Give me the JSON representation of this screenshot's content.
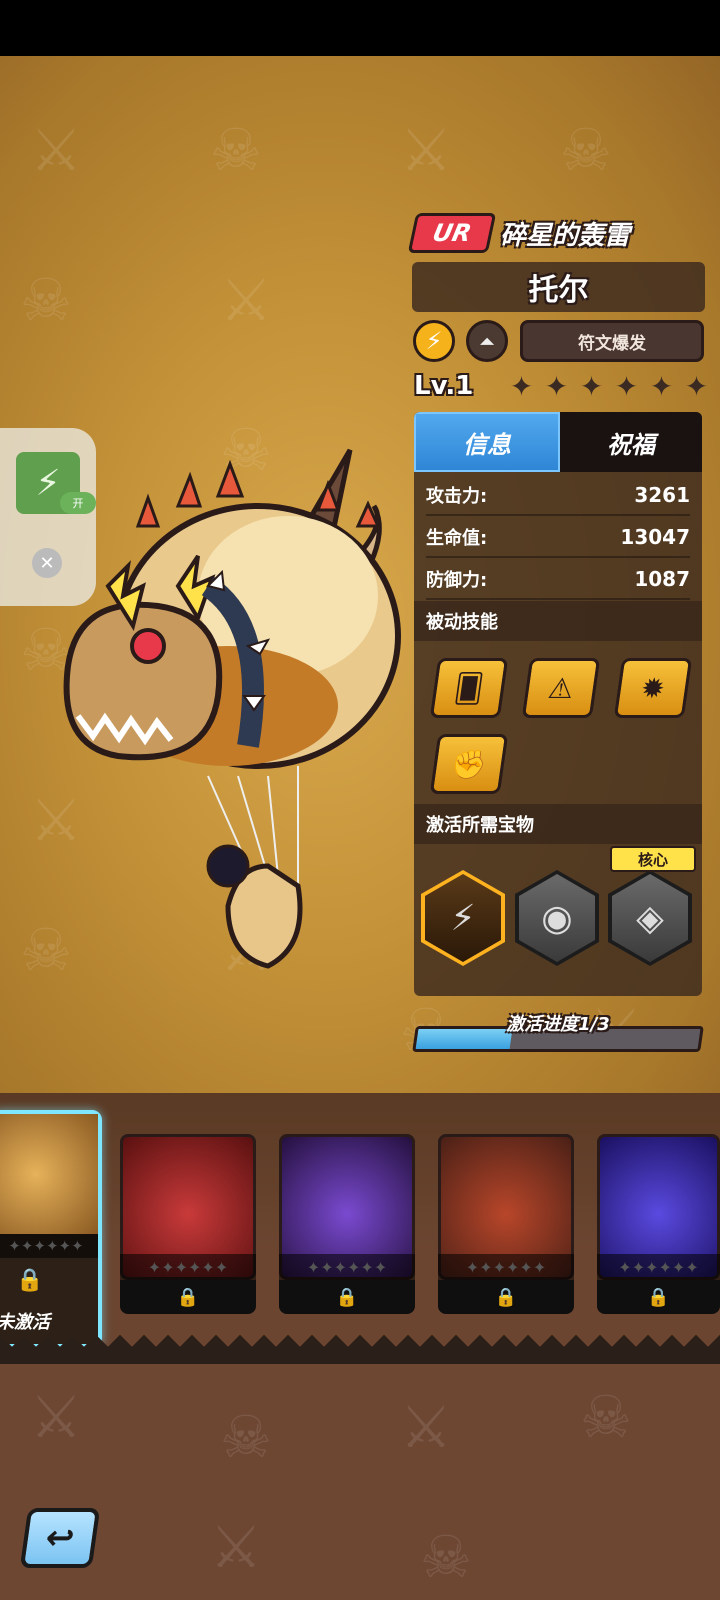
{
  "hero": {
    "rarity": "UR",
    "title": "碎星的轰雷",
    "name": "托尔",
    "rune_button": "符文爆发",
    "level": "Lv.1",
    "stars_total": 6,
    "stars_filled": 0
  },
  "tabs": [
    {
      "label": "信息",
      "active": true
    },
    {
      "label": "祝福",
      "active": false
    }
  ],
  "stats": [
    {
      "label": "攻击力:",
      "value": "3261"
    },
    {
      "label": "生命值:",
      "value": "13047"
    },
    {
      "label": "防御力:",
      "value": "1087"
    }
  ],
  "sections": {
    "passive_skills": "被动技能",
    "required_treasures": "激活所需宝物",
    "core_badge": "核心"
  },
  "passive_skills": [
    {
      "icon": "cards-dice-icon"
    },
    {
      "icon": "lightning-triangle-icon"
    },
    {
      "icon": "burst-star-icon"
    },
    {
      "icon": "fist-icon"
    }
  ],
  "treasures": [
    {
      "icon": "lightning-hammer-icon",
      "owned": true
    },
    {
      "icon": "dark-eye-relic-icon",
      "owned": false
    },
    {
      "icon": "pendant-relic-icon",
      "owned": false,
      "core": true
    }
  ],
  "activation": {
    "label": "激活进度1/3",
    "current": 1,
    "total": 3
  },
  "side_widget": {
    "toggle_label": "开"
  },
  "roster": {
    "selected_label": "未激活"
  },
  "colors": {
    "rarity_red": "#e8394b",
    "active_tab_blue": "#2f86d6",
    "progress_blue": "#3aa0de",
    "skill_gold": "#f6c03a",
    "selected_card_border": "#7fe6ff"
  }
}
